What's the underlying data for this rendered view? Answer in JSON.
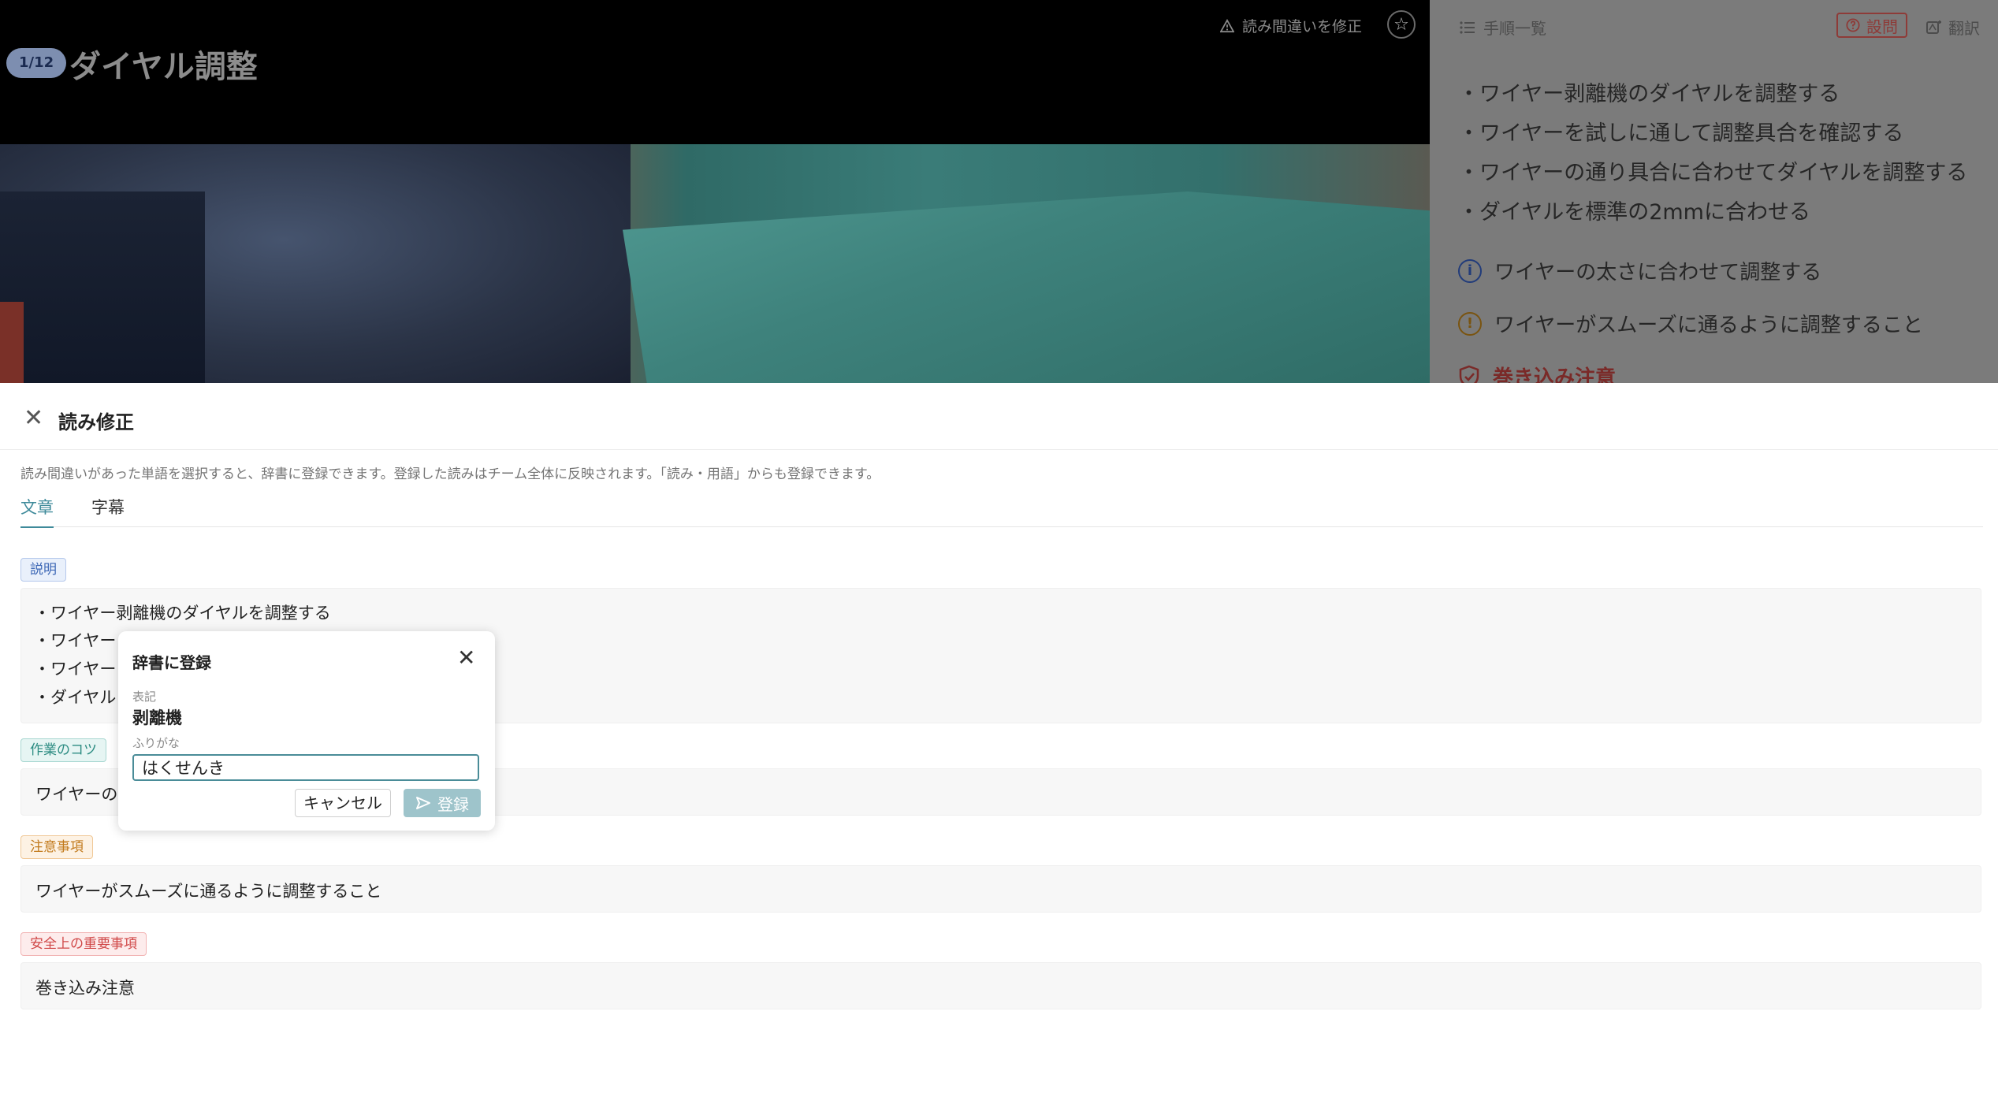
{
  "video": {
    "step_counter": "1/12",
    "step_title": "ダイヤル調整",
    "report_link": "読み間違いを修正",
    "report_icon": "warning-triangle-icon",
    "star_icon": "star-icon"
  },
  "side_panel": {
    "steps_list_label": "手順一覧",
    "question_label": "設問",
    "translate_label": "翻訳",
    "bullets": [
      "・ワイヤー剥離機のダイヤルを調整する",
      "・ワイヤーを試しに通して調整具合を確認する",
      "・ワイヤーの通り具合に合わせてダイヤルを調整する",
      "・ダイヤルを標準の2mmに合わせる"
    ],
    "tip": "ワイヤーの太さに合わせて調整する",
    "caution": "ワイヤーがスムーズに通るように調整すること",
    "safety": "巻き込み注意"
  },
  "sheet": {
    "title": "読み修正",
    "description": "読み間違いがあった単語を選択すると、辞書に登録できます。登録した読みはチーム全体に反映されます。「読み・用語」からも登録できます。",
    "tabs": [
      {
        "label": "文章",
        "active": true
      },
      {
        "label": "字幕",
        "active": false
      }
    ],
    "sections": {
      "description_tag": "説明",
      "description_lines": [
        "・ワイヤー剥離機のダイヤルを調整する",
        "・ワイヤー",
        "・ワイヤー",
        "・ダイヤル"
      ],
      "tip_tag": "作業のコツ",
      "tip_text": "ワイヤーの",
      "caution_tag": "注意事項",
      "caution_text": "ワイヤーがスムーズに通るように調整すること",
      "safety_tag": "安全上の重要事項",
      "safety_text": "巻き込み注意"
    }
  },
  "popup": {
    "title": "辞書に登録",
    "notation_label": "表記",
    "notation_value": "剥離機",
    "furigana_label": "ふりがな",
    "furigana_value": "はくせんき",
    "cancel_label": "キャンセル",
    "submit_label": "登録"
  },
  "colors": {
    "accent": "#3e8a9a",
    "submit_disabled": "#9ec4cb",
    "tag_blue": "#3b66b5",
    "tag_teal": "#2c8c82",
    "tag_orange": "#c27a1c",
    "tag_red": "#d04848"
  }
}
